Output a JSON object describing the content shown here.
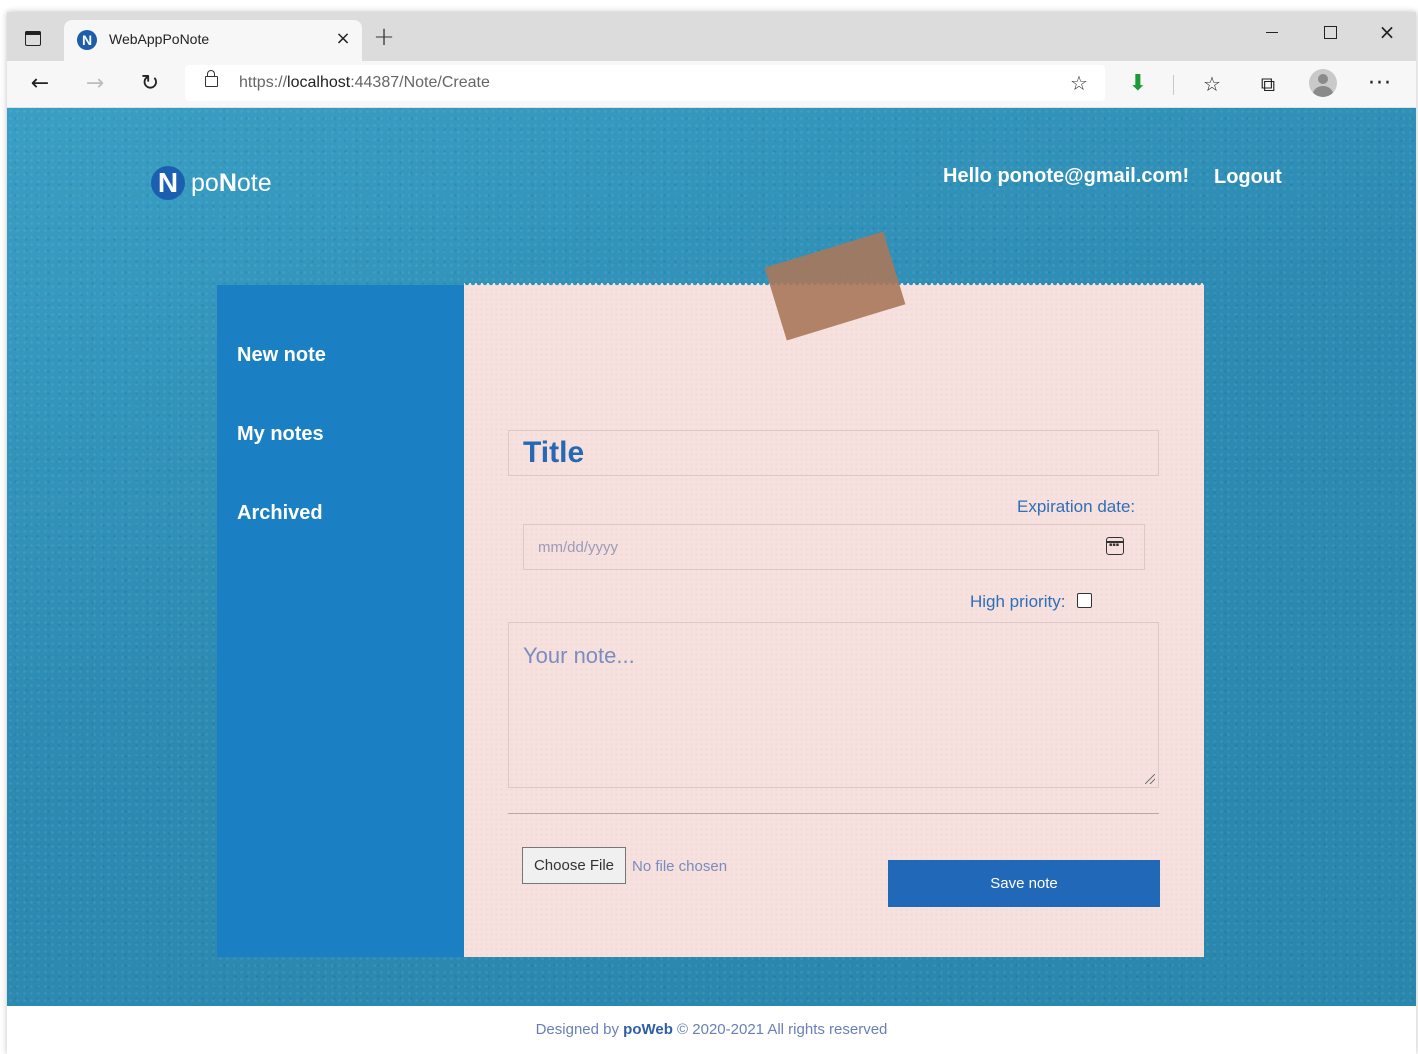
{
  "browser": {
    "tab_title": "WebAppPoNote",
    "tab_favicon_letter": "N",
    "new_tab_glyph": "+",
    "close_glyph": "×",
    "url_prefix": "https://",
    "url_host": "localhost",
    "url_rest": ":44387/Note/Create",
    "icons": [
      "tab-actions-icon",
      "back-icon",
      "forward-icon",
      "reload-icon",
      "lock-icon",
      "add-favorite-icon",
      "download-icon",
      "favorites-icon",
      "collections-icon",
      "profile-icon",
      "more-icon",
      "minimize-icon",
      "maximize-icon",
      "close-icon"
    ]
  },
  "header": {
    "brand_mark": "N",
    "brand_po": "po",
    "brand_n": "N",
    "brand_ote": "ote",
    "greeting": "Hello ponote@gmail.com!",
    "logout": "Logout"
  },
  "sidebar": {
    "items": [
      {
        "label": "New note"
      },
      {
        "label": "My notes"
      },
      {
        "label": "Archived"
      }
    ]
  },
  "form": {
    "title_placeholder": "Title",
    "expiration_label": "Expiration date:",
    "date_placeholder": "mm/dd/yyyy",
    "priority_label": "High priority:",
    "priority_checked": false,
    "note_placeholder": "Your note...",
    "choose_file": "Choose File",
    "file_status": "No file chosen",
    "save_label": "Save note"
  },
  "footer": {
    "prefix": "Designed by",
    "brand": "poWeb",
    "suffix": "© 2020-2021 All rights reserved"
  },
  "colors": {
    "sidebar": "#1b7fc4",
    "paper": "#f7e1de",
    "accent": "#2168b8",
    "background": "#2f8fb6"
  }
}
